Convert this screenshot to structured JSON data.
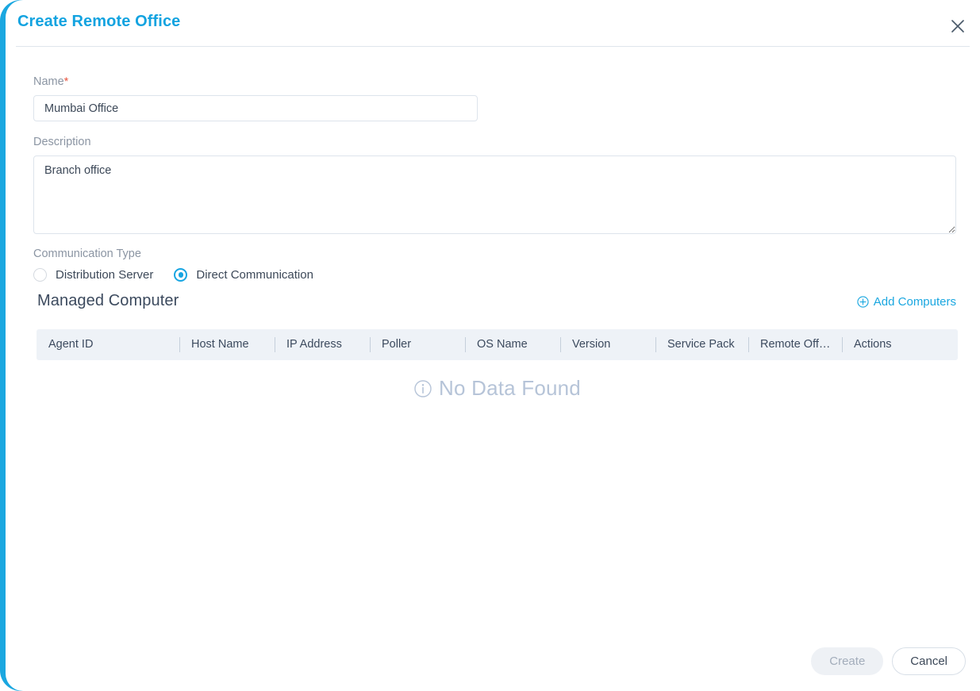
{
  "dialog": {
    "title": "Create Remote Office",
    "close_icon": "close-icon"
  },
  "form": {
    "name": {
      "label": "Name",
      "required_marker": "*",
      "value": "Mumbai Office",
      "placeholder": ""
    },
    "description": {
      "label": "Description",
      "value": "Branch office",
      "placeholder": ""
    },
    "communication_type": {
      "label": "Communication Type",
      "options": [
        {
          "label": "Distribution Server",
          "selected": false
        },
        {
          "label": "Direct Communication",
          "selected": true
        }
      ]
    }
  },
  "managed_computer": {
    "title": "Managed Computer",
    "add_button": {
      "label": "Add Computers",
      "icon": "plus-circle-icon"
    },
    "table": {
      "columns": [
        "Agent ID",
        "Host Name",
        "IP Address",
        "Poller",
        "OS Name",
        "Version",
        "Service Pack",
        "Remote Off…",
        "Actions"
      ],
      "rows": [],
      "empty_state": {
        "icon": "info-circle-icon",
        "text": "No Data Found"
      }
    }
  },
  "footer": {
    "create_label": "Create",
    "create_disabled": true,
    "cancel_label": "Cancel"
  },
  "colors": {
    "accent": "#1aa7e0",
    "title": "#13a3e0",
    "link": "#1aa7e0",
    "required": "#e8503a",
    "table_header_bg": "#eef2f7",
    "empty_text": "#b6c4d8"
  }
}
